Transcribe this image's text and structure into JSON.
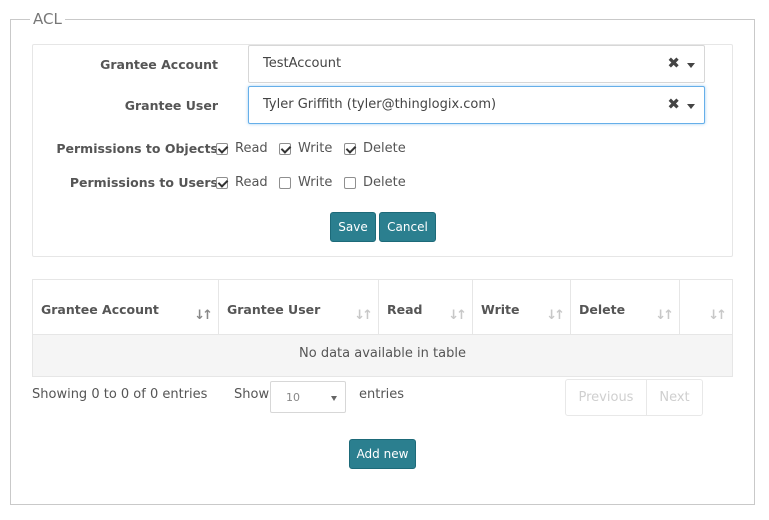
{
  "legend": "ACL",
  "form": {
    "grantee_account": {
      "label": "Grantee Account",
      "value": "TestAccount",
      "clear_glyph": "✖"
    },
    "grantee_user": {
      "label": "Grantee User",
      "value": "Tyler Griffith (tyler@thinglogix.com)",
      "clear_glyph": "✖"
    },
    "permissions_objects": {
      "label": "Permissions to Objects",
      "options": [
        {
          "label": "Read",
          "checked": true
        },
        {
          "label": "Write",
          "checked": true
        },
        {
          "label": "Delete",
          "checked": true
        }
      ]
    },
    "permissions_users": {
      "label": "Permissions to Users",
      "options": [
        {
          "label": "Read",
          "checked": true
        },
        {
          "label": "Write",
          "checked": false
        },
        {
          "label": "Delete",
          "checked": false
        }
      ]
    },
    "save_label": "Save",
    "cancel_label": "Cancel"
  },
  "table": {
    "columns": [
      "Grantee Account",
      "Grantee User",
      "Read",
      "Write",
      "Delete",
      ""
    ],
    "sort_icon": "↓↑",
    "empty_text": "No data available in table"
  },
  "footer": {
    "info": "Showing 0 to 0 of 0 entries",
    "show_label": "Show",
    "page_length": "10",
    "entries_label": "entries",
    "previous": "Previous",
    "next": "Next",
    "add_new": "Add new"
  },
  "colors": {
    "button": "#2b7f8f",
    "focus": "#66afe9"
  }
}
